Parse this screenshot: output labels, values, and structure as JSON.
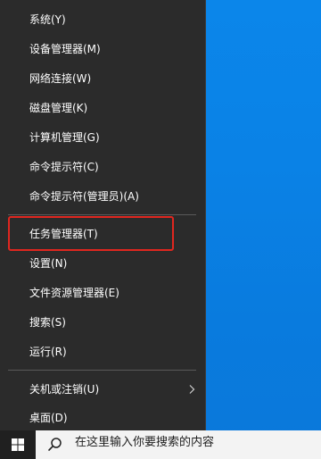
{
  "menu": {
    "items": [
      {
        "label": "系统(Y)"
      },
      {
        "label": "设备管理器(M)"
      },
      {
        "label": "网络连接(W)"
      },
      {
        "label": "磁盘管理(K)"
      },
      {
        "label": "计算机管理(G)"
      },
      {
        "label": "命令提示符(C)"
      },
      {
        "label": "命令提示符(管理员)(A)"
      },
      {
        "label": "任务管理器(T)"
      },
      {
        "label": "设置(N)"
      },
      {
        "label": "文件资源管理器(E)"
      },
      {
        "label": "搜索(S)"
      },
      {
        "label": "运行(R)"
      },
      {
        "label": "关机或注销(U)",
        "icon": "chevron-right-icon"
      },
      {
        "label": "桌面(D)"
      }
    ],
    "highlighted_item": "任务管理器(T)",
    "highlight_color": "#e0261f"
  },
  "taskbar": {
    "start_icon": "windows-logo-icon",
    "search_icon": "search-icon",
    "search_text": "在这里输入你要搜索的内容"
  },
  "colors": {
    "menu_background": "#2b2b2b",
    "desktop_blue": "#0a82e6"
  }
}
